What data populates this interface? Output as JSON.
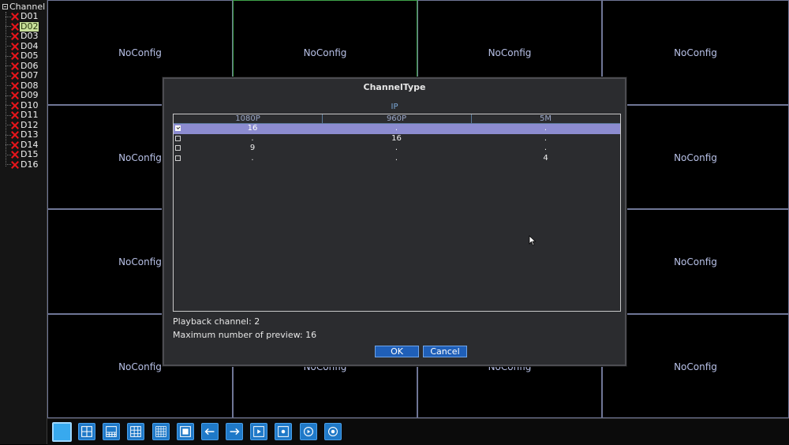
{
  "sidebar": {
    "root_label": "Channel",
    "selected": "D02",
    "channels": [
      "D01",
      "D02",
      "D03",
      "D04",
      "D05",
      "D06",
      "D07",
      "D08",
      "D09",
      "D10",
      "D11",
      "D12",
      "D13",
      "D14",
      "D15",
      "D16"
    ]
  },
  "grid": {
    "cell_label": "NoConfig",
    "rows": 4,
    "cols": 4,
    "active_cell": 1
  },
  "dialog": {
    "title": "ChannelType",
    "group_label": "IP",
    "columns": [
      "1080P",
      "960P",
      "5M"
    ],
    "rows": [
      {
        "checked": true,
        "values": [
          "16",
          ".",
          "."
        ]
      },
      {
        "checked": false,
        "values": [
          ".",
          "16",
          "."
        ]
      },
      {
        "checked": false,
        "values": [
          "9",
          ".",
          "."
        ]
      },
      {
        "checked": false,
        "values": [
          ".",
          ".",
          "4"
        ]
      }
    ],
    "playback_text": "Playback channel: 2",
    "preview_text": "Maximum number of preview: 16",
    "ok_label": "OK",
    "cancel_label": "Cancel"
  },
  "toolbar": {
    "buttons": [
      "single-view-icon",
      "quad-view-icon",
      "eight-view-icon",
      "nine-view-icon",
      "sixteen-view-icon",
      "fullscreen-icon",
      "arrow-left-icon",
      "arrow-right-icon",
      "play-icon",
      "record-icon",
      "playback-icon",
      "snapshot-icon"
    ],
    "active_index": 0
  },
  "colors": {
    "accent": "#1f79c8",
    "grid_border": "#6f7696",
    "active_border": "#3fa34a",
    "selected_row": "#8c8cd0",
    "error_x": "#e8151b"
  }
}
